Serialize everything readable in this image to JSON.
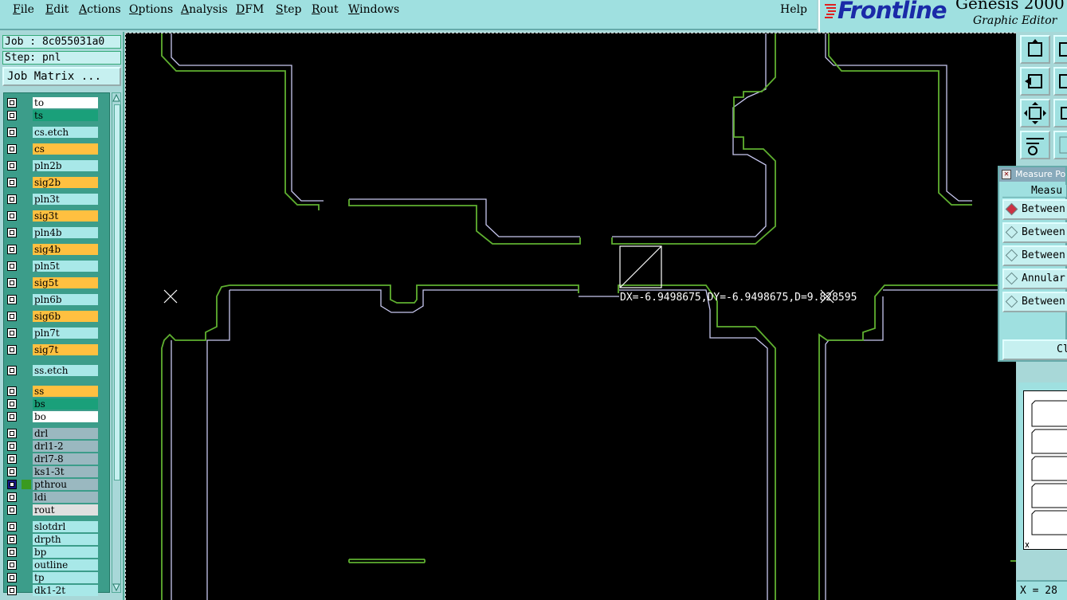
{
  "menubar": {
    "items": [
      {
        "mnemonic": "F",
        "rest": "ile"
      },
      {
        "mnemonic": "E",
        "rest": "dit"
      },
      {
        "mnemonic": "A",
        "rest": "ctions"
      },
      {
        "mnemonic": "O",
        "rest": "ptions"
      },
      {
        "mnemonic": "A",
        "rest": "nalysis"
      },
      {
        "mnemonic": "D",
        "rest": "FM"
      },
      {
        "mnemonic": "S",
        "rest": "tep"
      },
      {
        "mnemonic": "R",
        "rest": "out"
      },
      {
        "mnemonic": "W",
        "rest": "indows"
      }
    ],
    "help": "Help"
  },
  "branding": {
    "logo": "Frontline",
    "product": "Genesis 2000",
    "subtitle": "Graphic Editor",
    "logo_color": "#1a2aa8",
    "logo_mark_color": "#e02020"
  },
  "job_info": {
    "job": "Job : 8c055031a0",
    "step": "Step: pnl",
    "matrix_button": "Job Matrix ..."
  },
  "layers": [
    {
      "name": "to",
      "color": "#ffffff"
    },
    {
      "name": "ts",
      "color": "#1aa07a"
    },
    {
      "name": "cs.etch",
      "color": "#a8e8e8"
    },
    {
      "name": "cs",
      "color": "#ffc040"
    },
    {
      "name": "pln2b",
      "color": "#a8e8e8"
    },
    {
      "name": "sig2b",
      "color": "#ffc040"
    },
    {
      "name": "pln3t",
      "color": "#a8e8e8"
    },
    {
      "name": "sig3t",
      "color": "#ffc040"
    },
    {
      "name": "pln4b",
      "color": "#a8e8e8"
    },
    {
      "name": "sig4b",
      "color": "#ffc040"
    },
    {
      "name": "pln5t",
      "color": "#a8e8e8"
    },
    {
      "name": "sig5t",
      "color": "#ffc040"
    },
    {
      "name": "pln6b",
      "color": "#a8e8e8"
    },
    {
      "name": "sig6b",
      "color": "#ffc040"
    },
    {
      "name": "pln7t",
      "color": "#a8e8e8"
    },
    {
      "name": "sig7t",
      "color": "#ffc040"
    },
    {
      "name": "ss.etch",
      "color": "#a8e8e8"
    },
    {
      "name": "ss",
      "color": "#ffc040"
    },
    {
      "name": "bs",
      "color": "#1aa07a"
    },
    {
      "name": "bo",
      "color": "#ffffff"
    },
    {
      "name": "drl",
      "color": "#9ab8c0"
    },
    {
      "name": "drl1-2",
      "color": "#9ab8c0"
    },
    {
      "name": "drl7-8",
      "color": "#9ab8c0"
    },
    {
      "name": "ks1-3t",
      "color": "#9ab8c0"
    },
    {
      "name": "pthrou",
      "color": "#9ab8c0",
      "active": true
    },
    {
      "name": "ldi",
      "color": "#9ab8c0"
    },
    {
      "name": "rout",
      "color": "#e0e0e0"
    },
    {
      "name": "slotdrl",
      "color": "#a8e8e8"
    },
    {
      "name": "drpth",
      "color": "#a8e8e8"
    },
    {
      "name": "bp",
      "color": "#a8e8e8"
    },
    {
      "name": "outline",
      "color": "#a8e8e8"
    },
    {
      "name": "tp",
      "color": "#a8e8e8"
    },
    {
      "name": "dk1-2t",
      "color": "#a8e8e8"
    }
  ],
  "canvas": {
    "measure_text": "DX=-6.9498675,DY=-6.9498675,D=9.828595",
    "outline_color": "#5fb030",
    "feature_color": "#c8c8f0"
  },
  "measure_panel": {
    "title": "Measure Po",
    "header": "Measu",
    "options": [
      {
        "label": "Between",
        "selected": true
      },
      {
        "label": "Between",
        "selected": false
      },
      {
        "label": "Between",
        "selected": false
      },
      {
        "label": "Annular",
        "selected": false
      },
      {
        "label": "Between",
        "selected": false
      }
    ],
    "close_label": "Cl"
  },
  "status": {
    "coord": "X = 28"
  }
}
